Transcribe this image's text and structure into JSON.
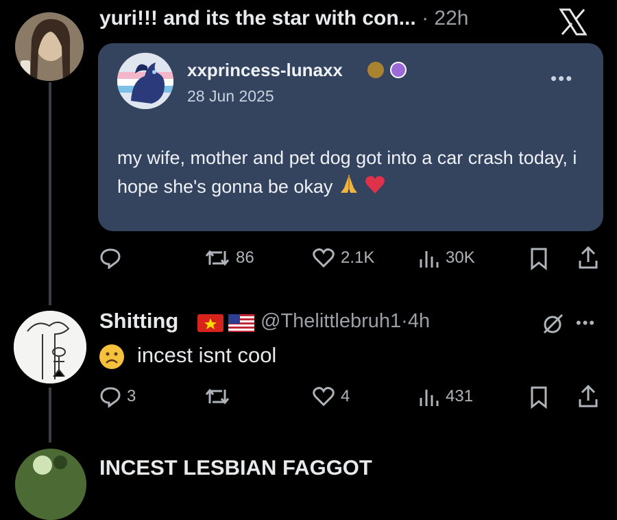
{
  "post1": {
    "author_text": "yuri!!! and its the star with con...",
    "separator": "·",
    "time": "22h"
  },
  "quote": {
    "username": "xxprincess-lunaxx",
    "date": "28 Jun 2025",
    "more": "•••",
    "text": "my wife, mother and pet dog got into a car crash today, i hope she's gonna be okay"
  },
  "post1_actions": {
    "reposts": "86",
    "likes": "2.1K",
    "views": "30K"
  },
  "reply": {
    "display_name": "Shitting",
    "handle": "@Thelittlebruh1",
    "separator": "·",
    "time": "4h",
    "more": "•••",
    "text": "incest isnt cool"
  },
  "reply_actions": {
    "replies": "3",
    "likes": "4",
    "views": "431"
  },
  "next_post": {
    "text": "INCEST LESBIAN FAGGOT"
  },
  "colors": {
    "background": "#000000",
    "card": "#34435e",
    "text": "#e7e9ea",
    "muted": "#9aa0a6"
  }
}
